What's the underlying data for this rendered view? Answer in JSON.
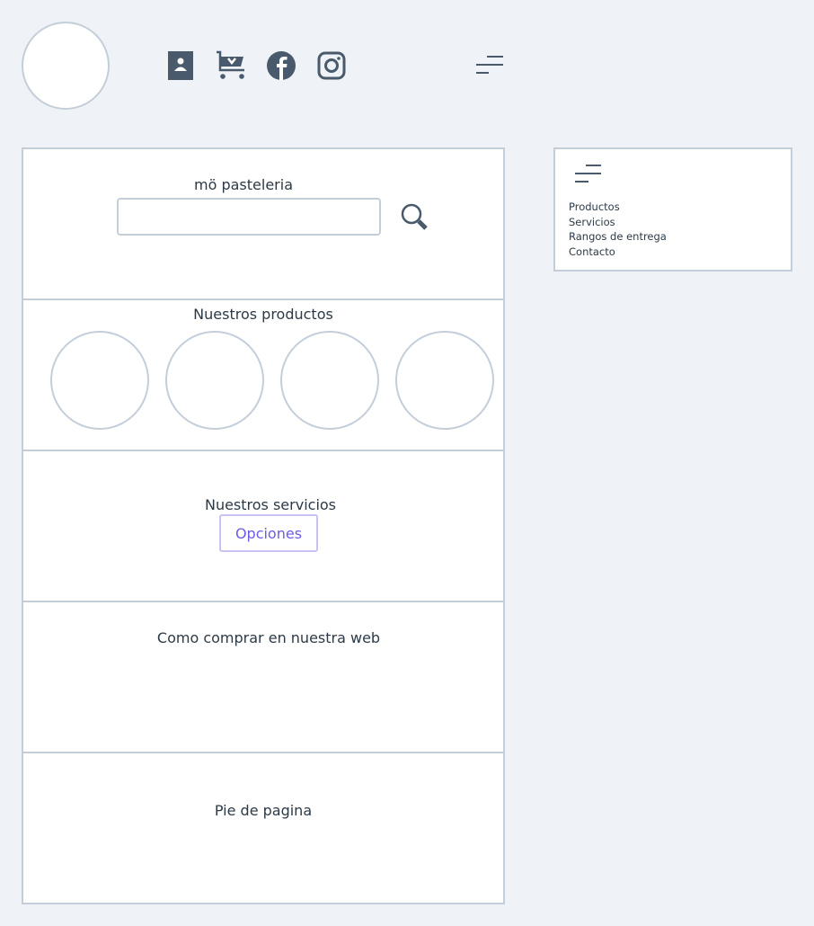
{
  "header": {
    "icons": [
      "user-card-icon",
      "cart-download-icon",
      "facebook-icon",
      "instagram-icon",
      "menu-icon"
    ]
  },
  "main": {
    "brand": "mö pasteleria",
    "search": {
      "value": "",
      "placeholder": ""
    },
    "products_title": "Nuestros productos",
    "services_title": "Nuestros servicios",
    "services_button": "Opciones",
    "howto_title": "Como comprar en nuestra web",
    "footer_title": "Pie de pagina"
  },
  "menu": {
    "items": [
      {
        "label": "Productos"
      },
      {
        "label": "Servicios"
      },
      {
        "label": "Rangos de entrega"
      },
      {
        "label": "Contacto"
      }
    ]
  },
  "colors": {
    "background": "#eff3f7",
    "border": "#c4ced9",
    "icon": "#485a6b",
    "accent": "#6b5ce7"
  }
}
